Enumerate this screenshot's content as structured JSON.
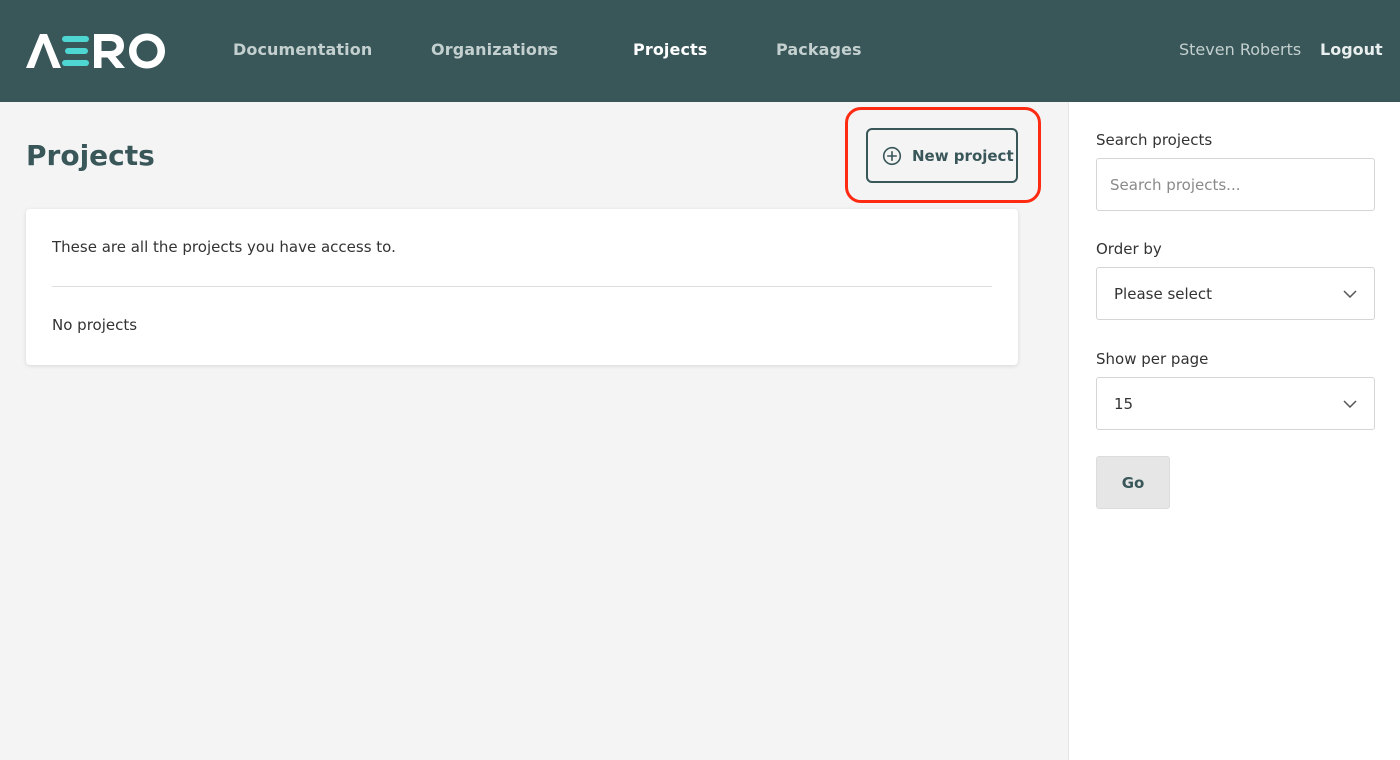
{
  "brand": {
    "logo_text": "AERO",
    "accent": "#4ed6d2",
    "bar_color": "#395659"
  },
  "nav": {
    "documentation": "Documentation",
    "organizations": "Organizations",
    "organizations_chevron": "›",
    "projects": "Projects",
    "packages": "Packages"
  },
  "user": {
    "name": "Steven Roberts",
    "logout": "Logout"
  },
  "page": {
    "title": "Projects",
    "new_project_label": "New project",
    "highlight_color": "#ff2a12"
  },
  "card": {
    "intro": "These are all the projects you have access to.",
    "empty": "No projects"
  },
  "sidebar": {
    "search_label": "Search projects",
    "search_placeholder": "Search projects...",
    "search_value": "",
    "order_label": "Order by",
    "order_value": "Please select",
    "per_page_label": "Show per page",
    "per_page_value": "15",
    "go_label": "Go"
  }
}
